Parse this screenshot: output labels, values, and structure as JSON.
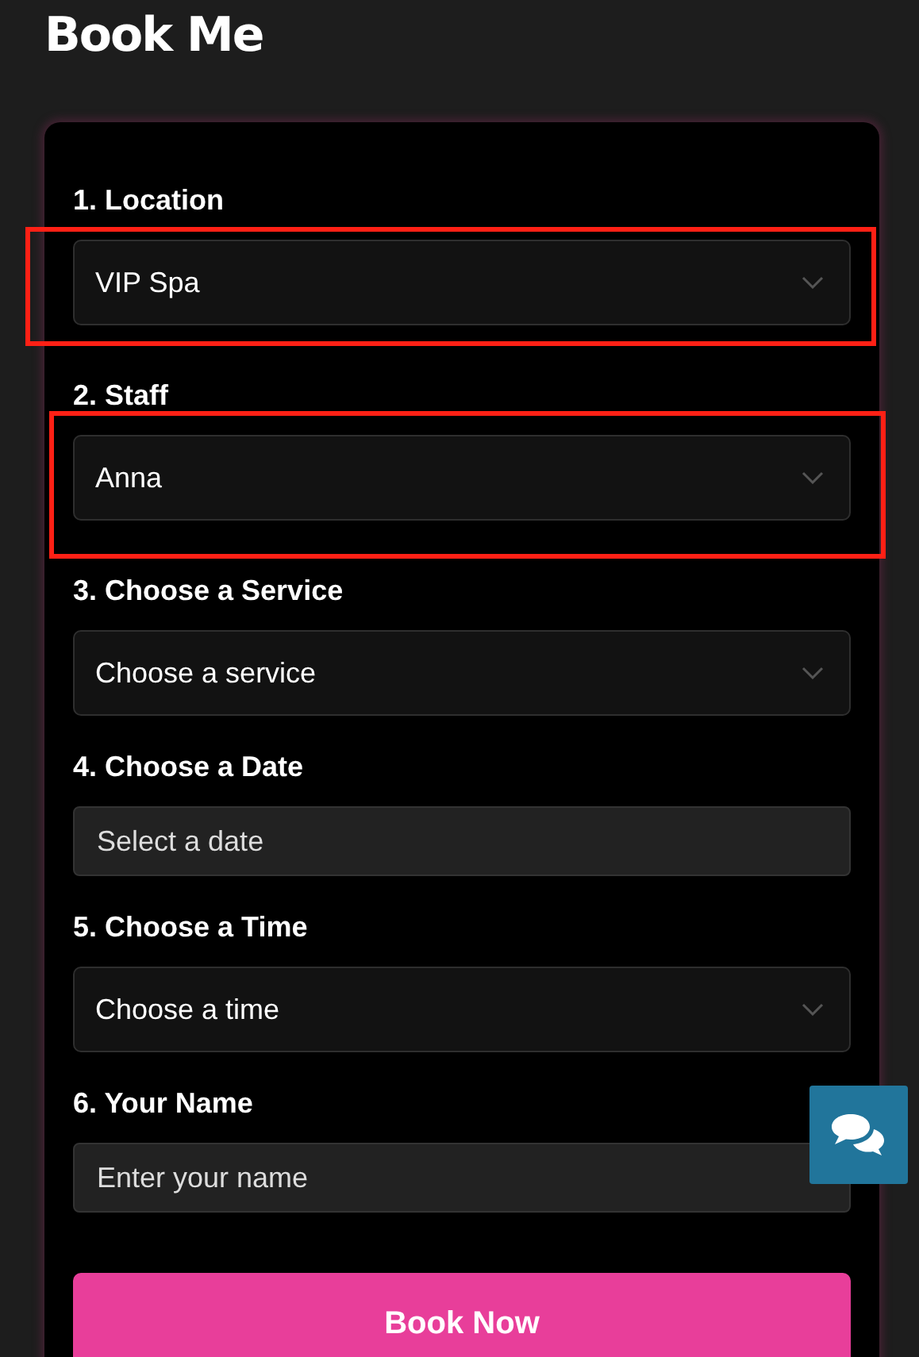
{
  "page": {
    "title": "Book Me"
  },
  "form": {
    "fields": [
      {
        "kind": "select",
        "label": "1. Location",
        "value": "VIP Spa",
        "highlighted": true
      },
      {
        "kind": "select",
        "label": "2. Staff",
        "value": "Anna",
        "highlighted": true
      },
      {
        "kind": "select",
        "label": "3. Choose a Service",
        "value": "Choose a service",
        "highlighted": false
      },
      {
        "kind": "input",
        "label": "4. Choose a Date",
        "placeholder": "Select a date",
        "highlighted": false
      },
      {
        "kind": "select",
        "label": "5. Choose a Time",
        "value": "Choose a time",
        "highlighted": false
      },
      {
        "kind": "input",
        "label": "6. Your Name",
        "placeholder": "Enter your name",
        "highlighted": false
      }
    ],
    "submit": "Book Now"
  }
}
